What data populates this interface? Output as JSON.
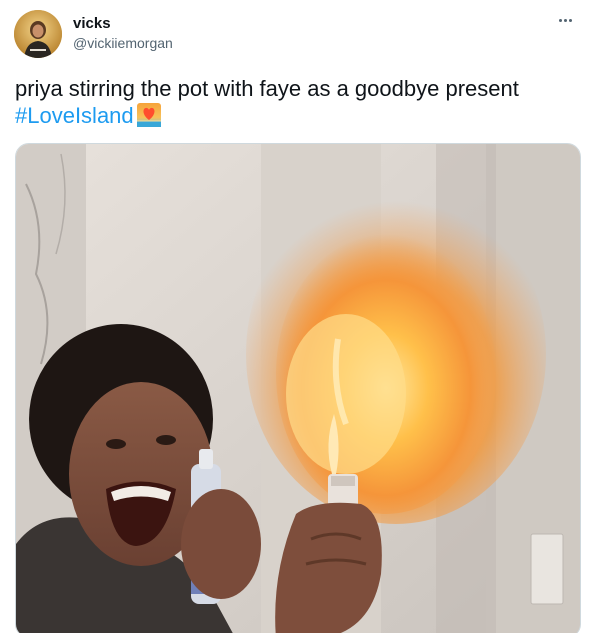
{
  "tweet": {
    "author": {
      "display_name": "vicks",
      "handle": "@vickiiemorgan",
      "avatar_icon": "avatar-photo"
    },
    "text": "priya stirring the pot with faye as a goodbye present",
    "hashtag": "#LoveIsland",
    "hashtag_emoji_icon": "love-island-heart-sunset-icon",
    "more_icon": "more-options-icon",
    "media": {
      "description_icon": "meme-photo",
      "type": "image"
    }
  },
  "colors": {
    "text": "#0f1419",
    "secondary": "#536471",
    "link": "#1d9bf0",
    "border": "#cfd9de"
  }
}
